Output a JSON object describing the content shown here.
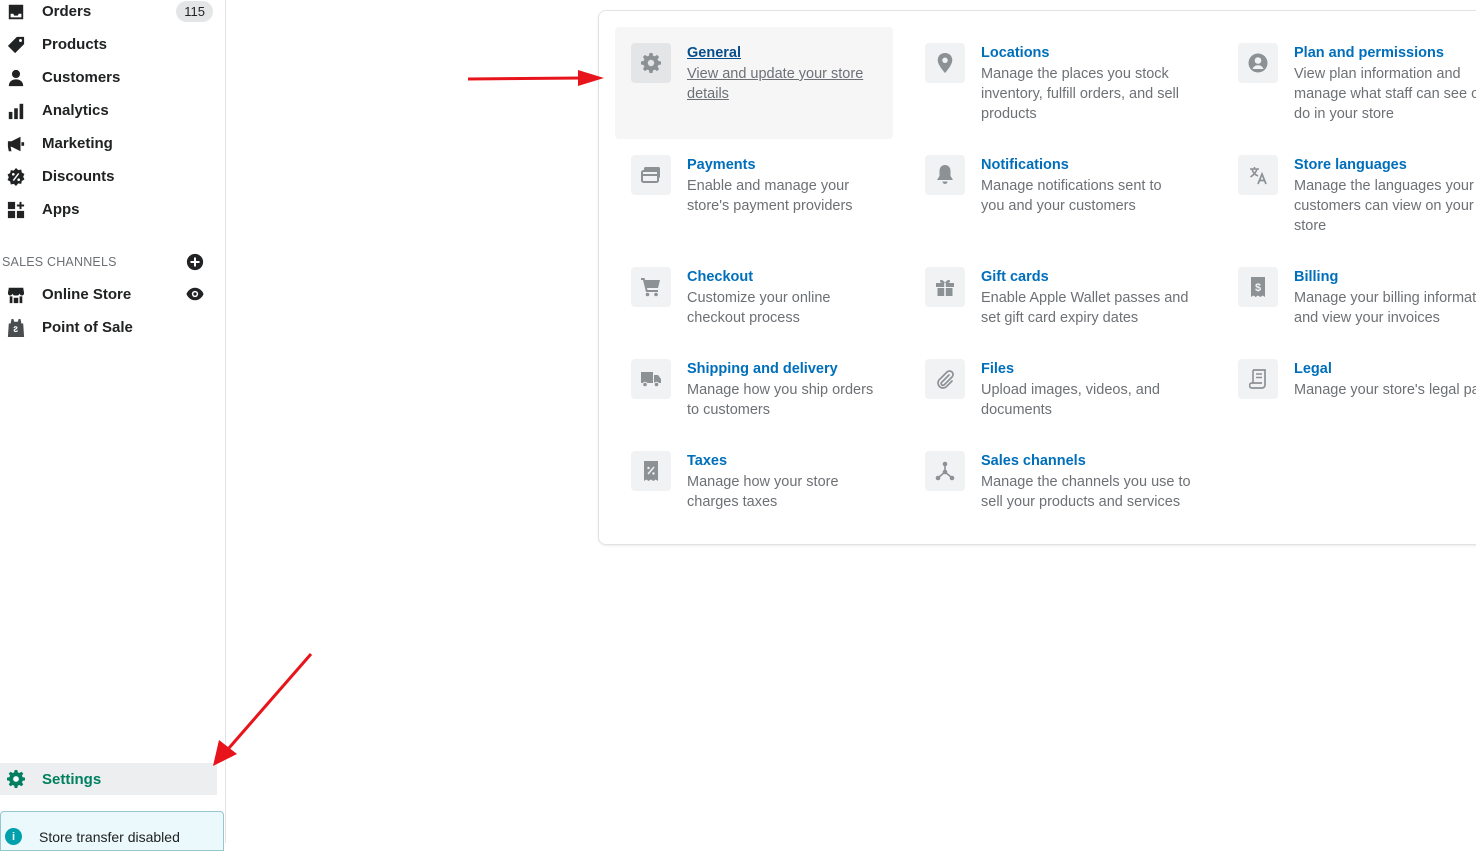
{
  "sidebar": {
    "orders": {
      "label": "Orders",
      "badge": "115"
    },
    "products": {
      "label": "Products"
    },
    "customers": {
      "label": "Customers"
    },
    "analytics": {
      "label": "Analytics"
    },
    "marketing": {
      "label": "Marketing"
    },
    "discounts": {
      "label": "Discounts"
    },
    "apps": {
      "label": "Apps"
    },
    "sales_channels_heading": "SALES CHANNELS",
    "online_store": {
      "label": "Online Store"
    },
    "point_of_sale": {
      "label": "Point of Sale"
    },
    "settings": {
      "label": "Settings"
    },
    "store_transfer": {
      "text": "Store transfer disabled"
    }
  },
  "settings": {
    "general": {
      "title": "General",
      "desc": "View and update your store details"
    },
    "locations": {
      "title": "Locations",
      "desc": "Manage the places you stock inventory, fulfill orders, and sell products"
    },
    "plan": {
      "title": "Plan and permissions",
      "desc": "View plan information and manage what staff can see or do in your store"
    },
    "payments": {
      "title": "Payments",
      "desc": "Enable and manage your store's payment providers"
    },
    "notifications": {
      "title": "Notifications",
      "desc": "Manage notifications sent to you and your customers"
    },
    "languages": {
      "title": "Store languages",
      "desc": "Manage the languages your customers can view on your store"
    },
    "checkout": {
      "title": "Checkout",
      "desc": "Customize your online checkout process"
    },
    "gift_cards": {
      "title": "Gift cards",
      "desc": "Enable Apple Wallet passes and set gift card expiry dates"
    },
    "billing": {
      "title": "Billing",
      "desc": "Manage your billing information and view your invoices"
    },
    "shipping": {
      "title": "Shipping and delivery",
      "desc": "Manage how you ship orders to customers"
    },
    "files": {
      "title": "Files",
      "desc": "Upload images, videos, and documents"
    },
    "legal": {
      "title": "Legal",
      "desc": "Manage your store's legal pages"
    },
    "taxes": {
      "title": "Taxes",
      "desc": "Manage how your store charges taxes"
    },
    "sales_channels": {
      "title": "Sales channels",
      "desc": "Manage the channels you use to sell your products and services"
    }
  },
  "colors": {
    "link": "#006fbb",
    "settings_active": "#008060",
    "annotation_arrow": "#e8141b"
  }
}
